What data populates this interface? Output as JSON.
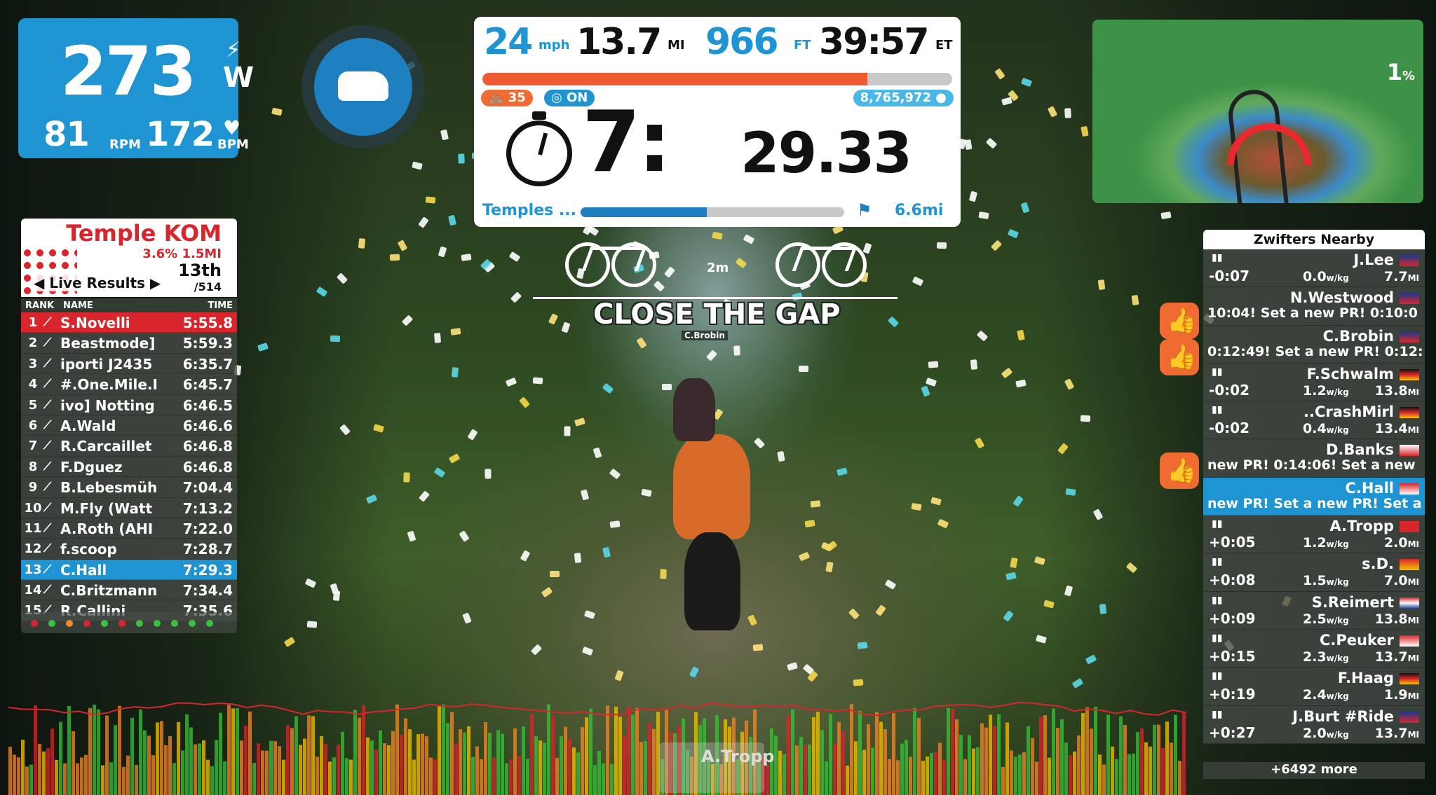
{
  "colors": {
    "accent": "#1e94d2",
    "orange": "#ef5b33",
    "red": "#d8262c",
    "panel": "#474b46"
  },
  "power": {
    "watts": "273",
    "watts_unit": "W",
    "cadence": "81",
    "cadence_unit": "RPM",
    "heart_rate": "172",
    "heart_rate_unit": "BPM",
    "power_icon": "lightning-icon",
    "heart_icon": "heart-icon"
  },
  "powerup": {
    "icon": "van-icon"
  },
  "stats": {
    "speed": "24",
    "speed_unit": "mph",
    "distance": "13.7",
    "distance_unit": "MI",
    "elevation": "966",
    "elevation_unit": "FT",
    "elapsed": "39:57",
    "elapsed_unit": "ET",
    "route_progress": 0.82,
    "level": "35",
    "steering": "ON",
    "drops": "8,765,972"
  },
  "segment": {
    "timer_main": "7:",
    "timer_small": "29.33",
    "name": "Temples ...",
    "progress": 0.48,
    "distance": "6.6mi"
  },
  "minimap": {
    "grade": "1",
    "grade_unit": "%"
  },
  "kom": {
    "title": "Temple KOM",
    "grade": "3.6%",
    "length": "1.5MI",
    "position": "13th",
    "of": "/514",
    "live_label": "Live Results",
    "col_rank": "RANK",
    "col_name": "NAME",
    "col_time": "TIME",
    "rows": [
      {
        "rank": "1",
        "name": "S.Novelli",
        "time": "5:55.8"
      },
      {
        "rank": "2",
        "name": "Beastmode]",
        "time": "5:59.3"
      },
      {
        "rank": "3",
        "name": "iporti J2435",
        "time": "6:35.7"
      },
      {
        "rank": "4",
        "name": "#.One.Mile.I",
        "time": "6:45.7"
      },
      {
        "rank": "5",
        "name": "ivo] Notting",
        "time": "6:46.5"
      },
      {
        "rank": "6",
        "name": "A.Wald",
        "time": "6:46.6"
      },
      {
        "rank": "7",
        "name": "R.Carcaillet",
        "time": "6:46.8"
      },
      {
        "rank": "8",
        "name": "F.Dguez",
        "time": "6:46.8"
      },
      {
        "rank": "9",
        "name": "B.Lebesmüh",
        "time": "7:04.4"
      },
      {
        "rank": "10",
        "name": "M.Fly (Watt",
        "time": "7:13.2"
      },
      {
        "rank": "11",
        "name": "A.Roth (AHI",
        "time": "7:22.0"
      },
      {
        "rank": "12",
        "name": "f.scoop",
        "time": "7:28.7"
      },
      {
        "rank": "13",
        "name": "C.Hall",
        "time": "7:29.3"
      },
      {
        "rank": "14",
        "name": "C.Britzmann",
        "time": "7:34.4"
      },
      {
        "rank": "15",
        "name": "R.Callini",
        "time": "7:35.6"
      }
    ],
    "dot_colors": [
      "#d8262c",
      "#3fbf3f",
      "#ef8b2c",
      "#d8262c",
      "#3fbf3f",
      "#d8262c",
      "#3fbf3f",
      "#3fbf3f",
      "#3fbf3f",
      "#3fbf3f",
      "#3fbf3f"
    ]
  },
  "close_gap": {
    "gap": "2m",
    "text": "CLOSE THE GAP",
    "rider": "C.Brobin"
  },
  "nearby": {
    "title": "Zwifters Nearby",
    "rows": [
      {
        "name": "J.Lee",
        "gap": "-0:07",
        "wkg": "0.0",
        "dist": "7.7",
        "flag": "uk"
      },
      {
        "name": "N.Westwood",
        "msg": "10:04!  Set a new PR! 0:10:0",
        "flag": "uk"
      },
      {
        "name": "C.Brobin",
        "msg": "0:12:49!  Set a new PR! 0:12:",
        "flag": "uk"
      },
      {
        "name": "F.Schwalm",
        "gap": "-0:02",
        "wkg": "1.2",
        "dist": "13.8",
        "flag": "de"
      },
      {
        "name": "..CrashMirl",
        "gap": "-0:02",
        "wkg": "0.4",
        "dist": "13.4",
        "flag": "de"
      },
      {
        "name": "D.Banks",
        "msg": "new PR! 0:14:06!  Set a new",
        "flag": "en"
      },
      {
        "name": "C.Hall",
        "msg": "new PR!  Set a new PR!  Set a",
        "flag": "us",
        "me": true
      },
      {
        "name": "A.Tropp",
        "gap": "+0:05",
        "wkg": "1.2",
        "dist": "2.0",
        "flag": "ch"
      },
      {
        "name": "s.D.",
        "gap": "+0:08",
        "wkg": "1.5",
        "dist": "7.0",
        "flag": "es"
      },
      {
        "name": "S.Reimert",
        "gap": "+0:09",
        "wkg": "2.5",
        "dist": "13.8",
        "flag": "nl"
      },
      {
        "name": "C.Peuker",
        "gap": "+0:15",
        "wkg": "2.3",
        "dist": "13.7",
        "flag": "at"
      },
      {
        "name": "F.Haag",
        "gap": "+0:19",
        "wkg": "2.4",
        "dist": "1.9",
        "flag": "de"
      },
      {
        "name": "J.Burt #Ride",
        "gap": "+0:27",
        "wkg": "2.0",
        "dist": "13.7",
        "flag": "uk"
      }
    ],
    "wkg_unit": "w/kg",
    "dist_unit": "MI",
    "more": "+6492 more"
  },
  "bottom_rider": {
    "name": "A.Tropp"
  }
}
